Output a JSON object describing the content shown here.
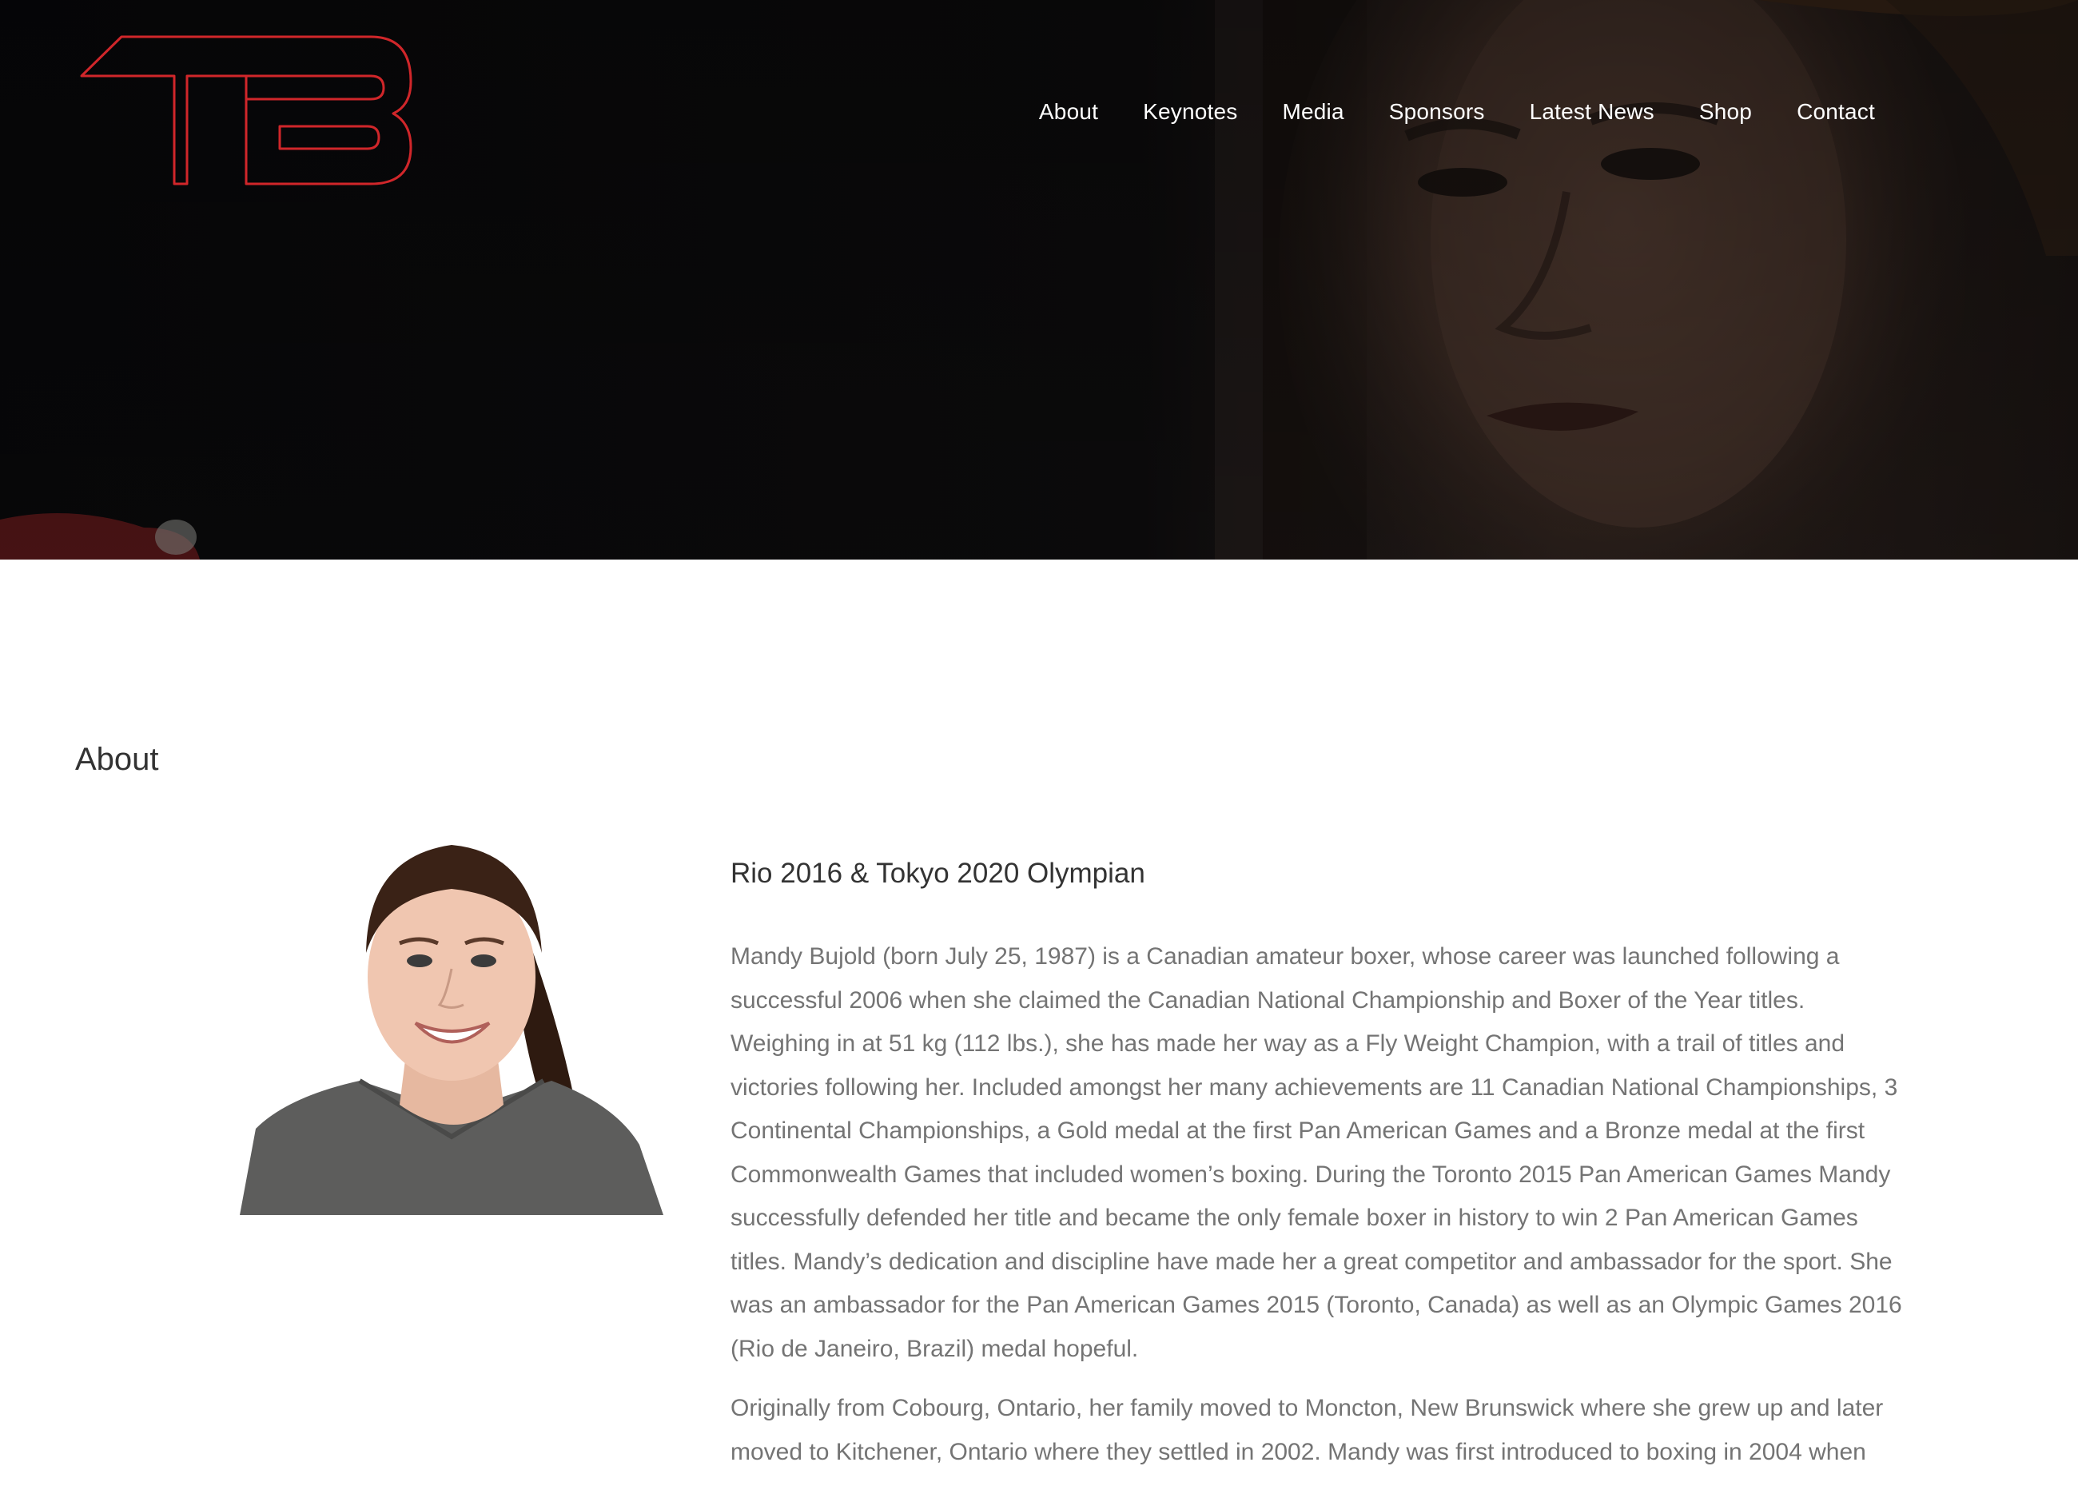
{
  "header": {
    "logo_text": "TB",
    "nav": [
      "About",
      "Keynotes",
      "Media",
      "Sponsors",
      "Latest News",
      "Shop",
      "Contact"
    ]
  },
  "main": {
    "section_title": "About",
    "subtitle": "Rio 2016 & Tokyo 2020 Olympian",
    "paragraphs": [
      "Mandy Bujold (born July 25, 1987) is a Canadian amateur boxer, whose career was launched following a successful 2006 when she claimed the Canadian National Championship and Boxer of the Year titles. Weighing in at 51 kg (112 lbs.), she has made her way as a Fly Weight Champion, with a trail of titles and victories following her. Included amongst her many achievements are 11 Canadian National Championships, 3 Continental Championships, a Gold medal at the first Pan American Games and a Bronze medal at the first Commonwealth Games that included women’s boxing. During the Toronto 2015 Pan American Games Mandy successfully defended her title and became the only female boxer in history to win 2 Pan American Games titles. Mandy’s dedication and discipline have made her a great competitor and ambassador for the sport. She was an ambassador for the Pan American Games 2015 (Toronto, Canada) as well as an Olympic Games 2016 (Rio de Janeiro, Brazil) medal hopeful.",
      "Originally from Cobourg, Ontario, her family moved to Moncton, New Brunswick where she grew up and later moved to Kitchener, Ontario where they settled in 2002. Mandy was first introduced to boxing in 2004 when"
    ]
  },
  "colors": {
    "logo_stroke": "#d0262a",
    "hero_background": "#0a0a0b",
    "nav_text": "#ffffff",
    "heading_text": "#333333",
    "body_text": "#747474"
  }
}
